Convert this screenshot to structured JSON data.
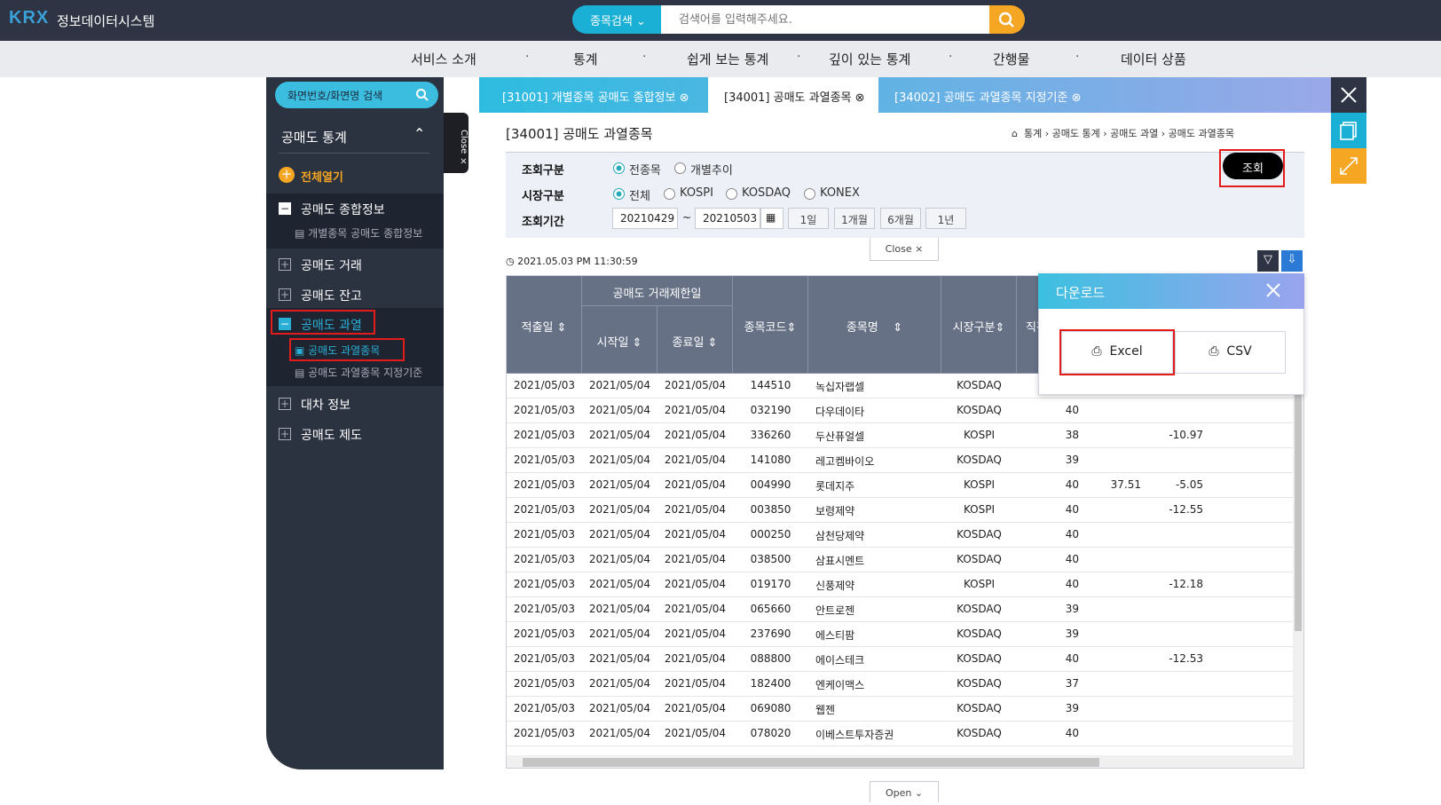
{
  "header": {
    "logo": "KRX",
    "title": "정보데이터시스템",
    "search_type": "종목검색",
    "search_placeholder": "검색어를 입력해주세요."
  },
  "nav": [
    "서비스 소개",
    "통계",
    "쉽게 보는 통계",
    "깊이 있는 통계",
    "간행물",
    "데이터 상품"
  ],
  "sidebar": {
    "search": "화면번호/화면명 검색",
    "close": "Close ×",
    "section": "공매도 통계",
    "open_all": "전체열기",
    "items": [
      {
        "label": "공매도 종합정보",
        "sub": [
          "개별종목 공매도 종합정보"
        ]
      },
      {
        "label": "공매도 거래"
      },
      {
        "label": "공매도 잔고"
      },
      {
        "label": "공매도 과열",
        "sub": [
          "공매도 과열종목",
          "공매도 과열종목 지정기준"
        ]
      },
      {
        "label": "대차 정보"
      },
      {
        "label": "공매도 제도"
      }
    ]
  },
  "tabs": [
    "[31001] 개별종목 공매도 종합정보",
    "[34001] 공매도 과열종목",
    "[34002] 공매도 과열종목 지정기준"
  ],
  "page": {
    "title": "[34001] 공매도 과열종목",
    "breadcrumb": [
      "통계",
      "공매도 통계",
      "공매도 과열",
      "공매도 과열종목"
    ]
  },
  "conditions": {
    "q_label": "조회구분",
    "q_opts": [
      "전종목",
      "개별추이"
    ],
    "m_label": "시장구분",
    "m_opts": [
      "전체",
      "KOSPI",
      "KOSDAQ",
      "KONEX"
    ],
    "p_label": "조회기간",
    "from": "20210429",
    "sep": "~",
    "to": "20210503",
    "periods": [
      "1일",
      "1개월",
      "6개월",
      "1년"
    ],
    "query_btn": "조회",
    "close": "Close ×"
  },
  "timestamp": "2021.05.03 PM 11:30:59",
  "grid": {
    "h_group": "공매도 거래제한일",
    "h_date": "적출일",
    "h_start": "시작일",
    "h_end": "종료일",
    "h_code": "종목코드",
    "h_name": "종목명",
    "h_mkt": "시장구분",
    "h_more": "직전",
    "rows": [
      [
        "2021/05/03",
        "2021/05/04",
        "2021/05/04",
        "144510",
        "녹십자랩셀",
        "KOSDAQ",
        "",
        "",
        ""
      ],
      [
        "2021/05/03",
        "2021/05/04",
        "2021/05/04",
        "032190",
        "다우데이타",
        "KOSDAQ",
        "40",
        "",
        ""
      ],
      [
        "2021/05/03",
        "2021/05/04",
        "2021/05/04",
        "336260",
        "두산퓨얼셀",
        "KOSPI",
        "38",
        "",
        "-10.97"
      ],
      [
        "2021/05/03",
        "2021/05/04",
        "2021/05/04",
        "141080",
        "레고켐바이오",
        "KOSDAQ",
        "39",
        "",
        ""
      ],
      [
        "2021/05/03",
        "2021/05/04",
        "2021/05/04",
        "004990",
        "롯데지주",
        "KOSPI",
        "40",
        "37.51",
        "-5.05"
      ],
      [
        "2021/05/03",
        "2021/05/04",
        "2021/05/04",
        "003850",
        "보령제약",
        "KOSPI",
        "40",
        "",
        "-12.55"
      ],
      [
        "2021/05/03",
        "2021/05/04",
        "2021/05/04",
        "000250",
        "삼천당제약",
        "KOSDAQ",
        "40",
        "",
        ""
      ],
      [
        "2021/05/03",
        "2021/05/04",
        "2021/05/04",
        "038500",
        "삼표시멘트",
        "KOSDAQ",
        "40",
        "",
        ""
      ],
      [
        "2021/05/03",
        "2021/05/04",
        "2021/05/04",
        "019170",
        "신풍제약",
        "KOSPI",
        "40",
        "",
        "-12.18"
      ],
      [
        "2021/05/03",
        "2021/05/04",
        "2021/05/04",
        "065660",
        "안트로젠",
        "KOSDAQ",
        "39",
        "",
        ""
      ],
      [
        "2021/05/03",
        "2021/05/04",
        "2021/05/04",
        "237690",
        "에스티팜",
        "KOSDAQ",
        "39",
        "",
        ""
      ],
      [
        "2021/05/03",
        "2021/05/04",
        "2021/05/04",
        "088800",
        "에이스테크",
        "KOSDAQ",
        "40",
        "",
        "-12.53"
      ],
      [
        "2021/05/03",
        "2021/05/04",
        "2021/05/04",
        "182400",
        "엔케이맥스",
        "KOSDAQ",
        "37",
        "",
        ""
      ],
      [
        "2021/05/03",
        "2021/05/04",
        "2021/05/04",
        "069080",
        "웹젠",
        "KOSDAQ",
        "39",
        "",
        ""
      ],
      [
        "2021/05/03",
        "2021/05/04",
        "2021/05/04",
        "078020",
        "이베스트투자증권",
        "KOSDAQ",
        "40",
        "",
        ""
      ]
    ]
  },
  "download": {
    "title": "다운로드",
    "excel": "Excel",
    "csv": "CSV"
  },
  "open": "Open ⌄"
}
